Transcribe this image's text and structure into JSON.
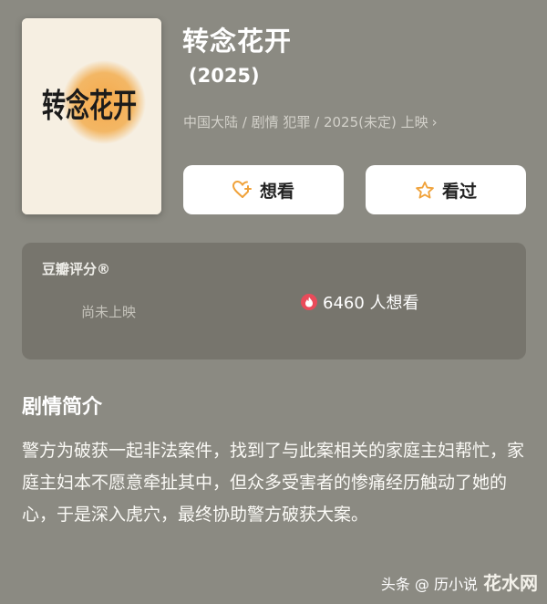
{
  "movie": {
    "title": "转念花开",
    "year": "(2025)",
    "meta": "中国大陆 / 剧情 犯罪 / 2025(未定) 上映",
    "poster_logo_text": "转念花开"
  },
  "actions": {
    "want_label": "想看",
    "seen_label": "看过"
  },
  "rating": {
    "label": "豆瓣评分®",
    "status": "尚未上映",
    "want_count": "6460 人想看"
  },
  "synopsis": {
    "heading": "剧情简介",
    "text": "警方为破获一起非法案件，找到了与此案相关的家庭主妇帮忙，家庭主妇本不愿意牵扯其中，但众多受害者的惨痛经历触动了她的心，于是深入虎穴，最终协助警方破获大案。"
  },
  "watermark": {
    "source": "头条 @ 历小说",
    "site": "花水网"
  },
  "colors": {
    "background": "#8b8a82",
    "card": "#77756d",
    "accent_orange": "#f0a23a",
    "flame_red": "#e94b5a"
  },
  "icons": {
    "want": "heart-plus-icon",
    "seen": "star-icon",
    "flame": "flame-icon",
    "chevron": "chevron-right-icon"
  }
}
